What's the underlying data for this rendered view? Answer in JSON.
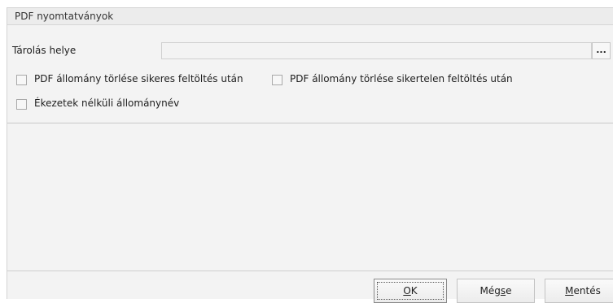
{
  "group": {
    "title": "PDF nyomtatványok"
  },
  "storage": {
    "label": "Tárolás helye",
    "value": "",
    "browse_label": "..."
  },
  "options": [
    {
      "label": "PDF állomány törlése sikeres feltöltés után",
      "checked": false
    },
    {
      "label": "PDF állomány törlése sikertelen feltöltés után",
      "checked": false
    },
    {
      "label": "Ékezetek nélküli állománynév",
      "checked": false
    }
  ],
  "buttons": {
    "ok_mnemonic": "O",
    "ok_rest": "K",
    "cancel_pre": "Még",
    "cancel_mnemonic": "s",
    "cancel_post": "e",
    "save_mnemonic": "M",
    "save_rest": "entés"
  }
}
